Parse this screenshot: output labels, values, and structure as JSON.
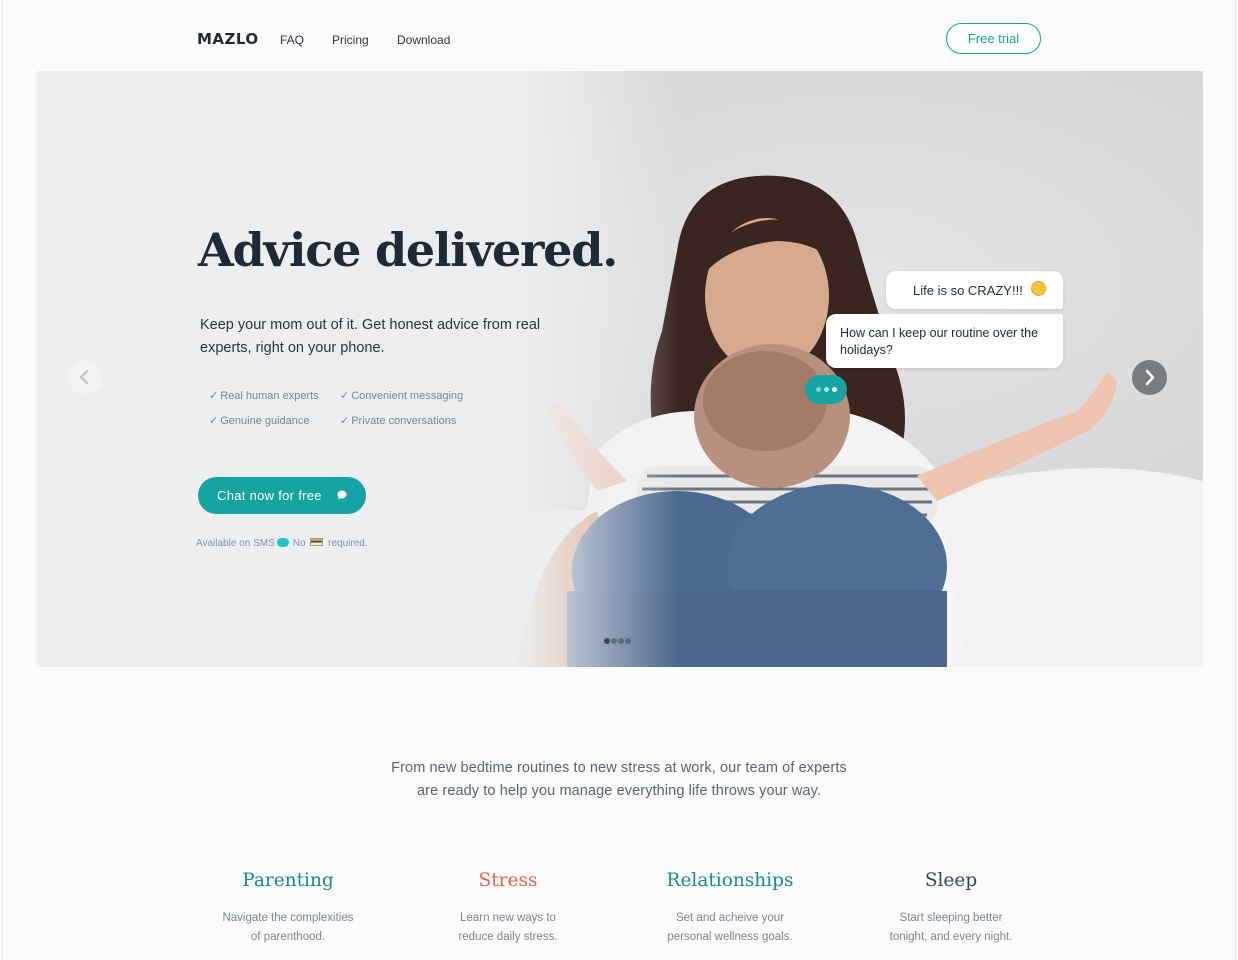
{
  "nav": {
    "logo": "MAZLO",
    "links": [
      "FAQ",
      "Pricing",
      "Download"
    ],
    "cta": "Free trial"
  },
  "hero": {
    "title": "Advice delivered.",
    "subtitle": "Keep your mom out of it. Get honest advice from real experts, right on your phone.",
    "features": [
      "Real human experts",
      "Convenient messaging",
      "Genuine guidance",
      "Private conversations"
    ],
    "check": "✓",
    "cta": "Chat now for free",
    "availability": {
      "prefix": "Available on SMS",
      "middle": "No",
      "suffix": "required."
    },
    "chat_bubbles": [
      "Life is so CRAZY!!!",
      "How can I keep our routine over the holidays?"
    ],
    "slide_count": 4,
    "active_slide": 1
  },
  "intro": {
    "line1": "From new bedtime routines to new stress at work, our team of experts",
    "line2": "are ready to help you manage everything life throws your way."
  },
  "categories": [
    {
      "title": "Parenting",
      "color": "#1a8a91",
      "line1": "Navigate the complexities",
      "line2": "of parenthood."
    },
    {
      "title": "Stress",
      "color": "#e3654b",
      "line1": "Learn new ways to",
      "line2": "reduce daily stress."
    },
    {
      "title": "Relationships",
      "color": "#1a8a91",
      "line1": "Set and acheive your",
      "line2": "personal wellness goals."
    },
    {
      "title": "Sleep",
      "color": "#3a4655",
      "line1": "Start sleeping better",
      "line2": "tonight, and every night."
    }
  ],
  "colors": {
    "accent": "#16a3a3",
    "heading": "#1f2a38",
    "muted": "#7d8590"
  },
  "icons": [
    "chevron-left-icon",
    "chevron-right-icon",
    "chat-bubble-icon",
    "sms-icon",
    "credit-card-icon",
    "emoji-icon"
  ]
}
